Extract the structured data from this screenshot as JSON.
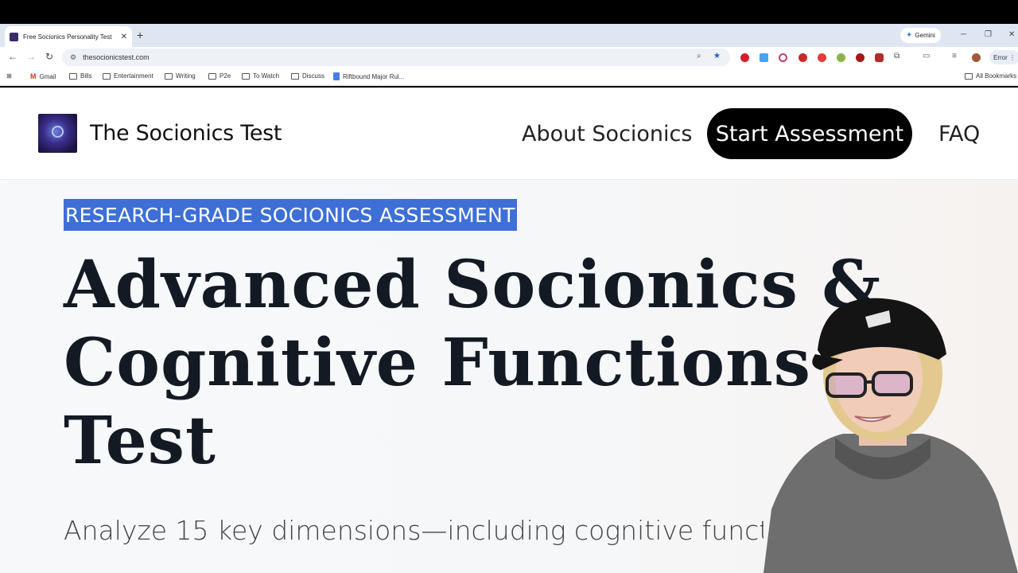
{
  "browser": {
    "tab_title": "Free Socionics Personality Test",
    "new_tab_label": "+",
    "gemini_label": "Gemini",
    "url": "thesocionicstest.com",
    "error_label": "Error",
    "bookmarks": [
      {
        "label": "Gmail",
        "type": "gmail"
      },
      {
        "label": "Bills",
        "type": "folder"
      },
      {
        "label": "Entertainment",
        "type": "folder"
      },
      {
        "label": "Writing",
        "type": "folder"
      },
      {
        "label": "P2e",
        "type": "folder"
      },
      {
        "label": "To Watch",
        "type": "folder"
      },
      {
        "label": "Discuss",
        "type": "folder"
      },
      {
        "label": "Riftbound Major Rul...",
        "type": "doc"
      }
    ],
    "all_bookmarks_label": "All Bookmarks"
  },
  "site": {
    "title": "The Socionics Test",
    "nav": {
      "about": "About Socionics",
      "cta": "Start Assessment",
      "faq": "FAQ"
    }
  },
  "hero": {
    "eyebrow": "RESEARCH-GRADE SOCIONICS ASSESSMENT",
    "headline_line1": "Advanced Socionics &",
    "headline_line2": "Cognitive Functions",
    "headline_line3": "Test",
    "subtitle": "Analyze 15 key dimensions—including cognitive functi"
  },
  "colors": {
    "highlight": "#3d6fd6",
    "cta_bg": "#000000",
    "headline": "#141a24"
  }
}
